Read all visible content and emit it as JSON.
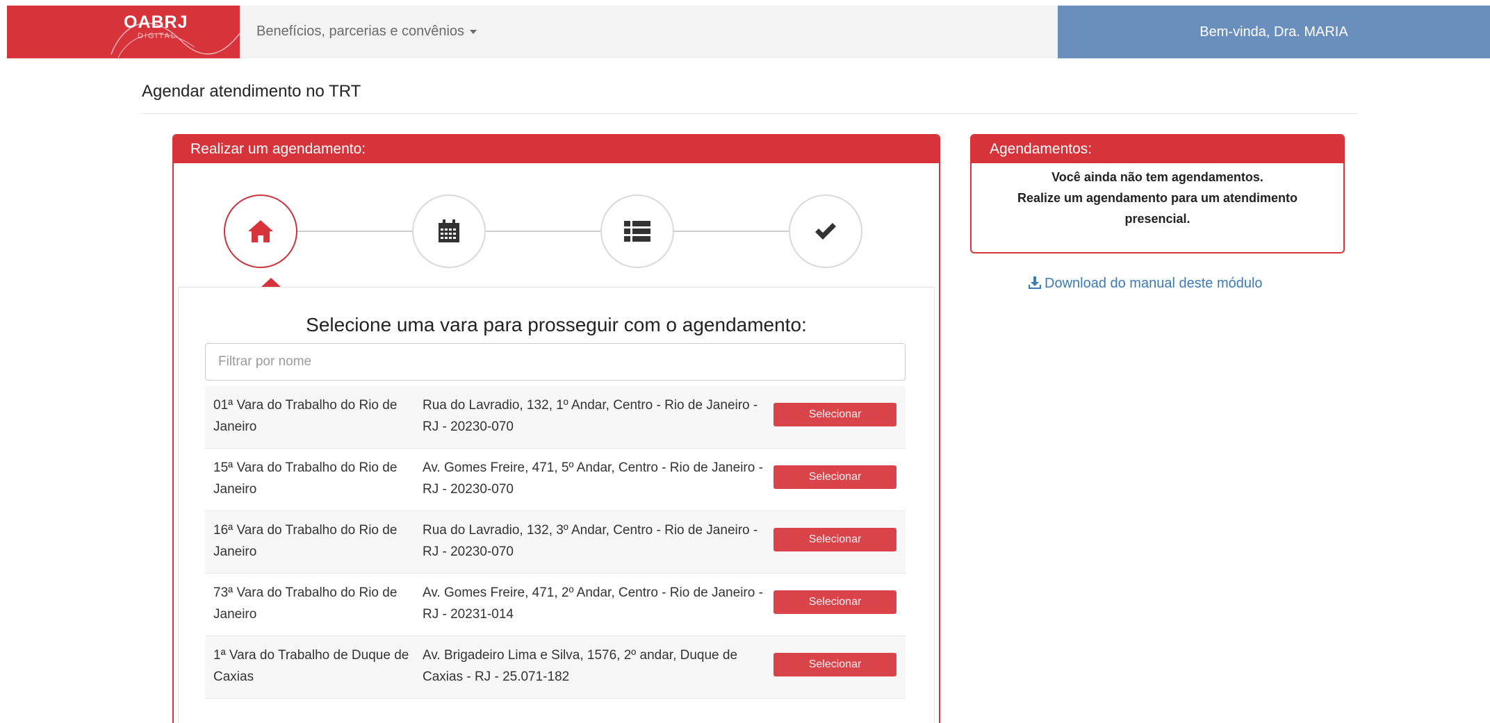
{
  "navbar": {
    "brand_text": "OABRJ",
    "brand_sub": "DIGITAL",
    "menu_label": "Benefícios, parcerias e convênios",
    "welcome": "Bem-vinda, Dra. MARIA"
  },
  "page": {
    "title": "Agendar atendimento no TRT"
  },
  "main_panel": {
    "heading": "Realizar um agendamento:",
    "steps": [
      {
        "icon": "home-icon",
        "active": true
      },
      {
        "icon": "calendar-icon",
        "active": false
      },
      {
        "icon": "list-icon",
        "active": false
      },
      {
        "icon": "checkmark-icon",
        "active": false
      }
    ],
    "prompt": "Selecione uma vara para prosseguir com o agendamento:",
    "filter_placeholder": "Filtrar por nome",
    "rows": [
      {
        "name": "01ª Vara do Trabalho do Rio de Janeiro",
        "address": "Rua do Lavradio, 132, 1º Andar, Centro - Rio de Janeiro - RJ - 20230-070",
        "button": "Selecionar"
      },
      {
        "name": "15ª Vara do Trabalho do Rio de Janeiro",
        "address": "Av. Gomes Freire, 471, 5º Andar, Centro - Rio de Janeiro - RJ - 20230-070",
        "button": "Selecionar"
      },
      {
        "name": "16ª Vara do Trabalho do Rio de Janeiro",
        "address": "Rua do Lavradio, 132, 3º Andar, Centro - Rio de Janeiro - RJ - 20230-070",
        "button": "Selecionar"
      },
      {
        "name": "73ª Vara do Trabalho do Rio de Janeiro",
        "address": "Av. Gomes Freire, 471, 2º Andar, Centro - Rio de Janeiro - RJ - 20231-014",
        "button": "Selecionar"
      },
      {
        "name": "1ª Vara do Trabalho de Duque de Caxias",
        "address": "Av. Brigadeiro Lima e Silva, 1576, 2º andar, Duque de Caxias - RJ - 25.071-182",
        "button": "Selecionar"
      }
    ]
  },
  "side_panel": {
    "heading": "Agendamentos:",
    "line1": "Você ainda não tem agendamentos.",
    "line2": "Realize um agendamento para um atendimento",
    "line3": "presencial."
  },
  "download": {
    "label": "Download do manual deste módulo",
    "icon": "download-icon"
  },
  "colors": {
    "brand_red": "#d6343a",
    "welcome_blue": "#6a8fbd",
    "button_red": "#d9434a",
    "link_blue": "#3a7ab7"
  }
}
